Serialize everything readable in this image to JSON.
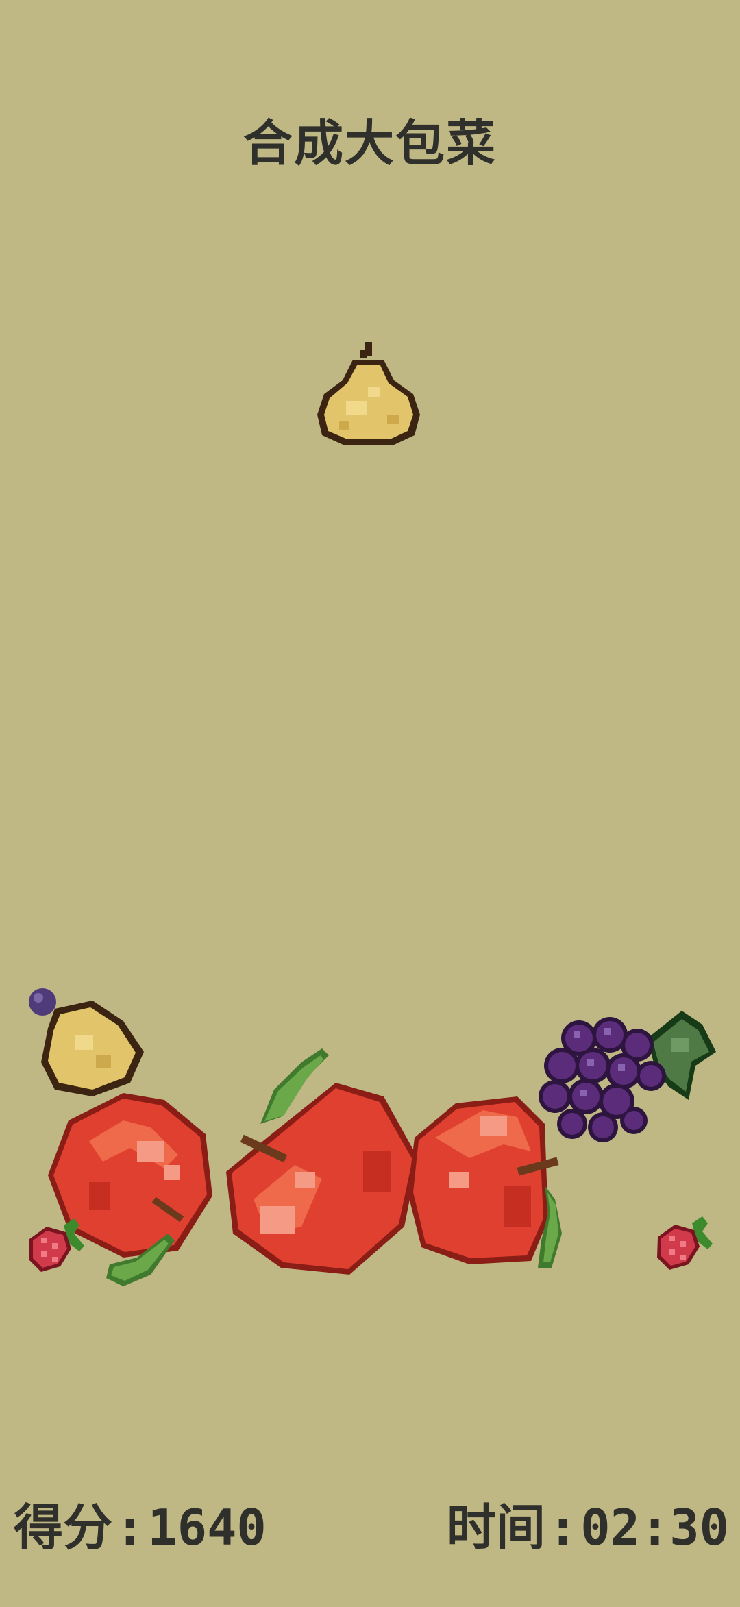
{
  "game": {
    "title": "合成大包菜"
  },
  "hud": {
    "score_label": "得分",
    "score_value": "1640",
    "time_label": "时间",
    "time_value": "02:30",
    "separator": ":"
  },
  "falling_fruit": {
    "kind": "pear"
  },
  "pile": [
    {
      "kind": "pear"
    },
    {
      "kind": "apple"
    },
    {
      "kind": "apple"
    },
    {
      "kind": "apple"
    },
    {
      "kind": "grapes"
    },
    {
      "kind": "raspberry"
    },
    {
      "kind": "raspberry"
    }
  ],
  "colors": {
    "background": "#bfb784",
    "text": "#2f2f2b",
    "apple": "#e0402f",
    "pear": "#e2c56a",
    "grapes": "#4f2a6e",
    "leaf": "#6aa84a"
  }
}
